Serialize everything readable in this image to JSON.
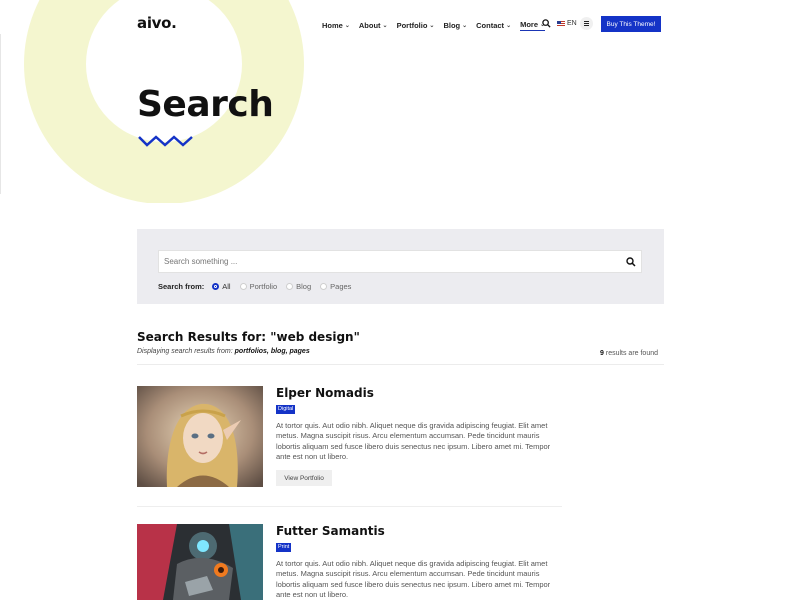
{
  "header": {
    "logo": "aivo.",
    "nav": [
      {
        "label": "Home"
      },
      {
        "label": "About"
      },
      {
        "label": "Portfolio"
      },
      {
        "label": "Blog"
      },
      {
        "label": "Contact"
      },
      {
        "label": "More"
      }
    ],
    "language": "EN",
    "buy_button": "Buy This Theme!"
  },
  "hero": {
    "title": "Search"
  },
  "search": {
    "placeholder": "Search something ...",
    "from_label": "Search from:",
    "options": [
      {
        "label": "All",
        "selected": true
      },
      {
        "label": "Portfolio",
        "selected": false
      },
      {
        "label": "Blog",
        "selected": false
      },
      {
        "label": "Pages",
        "selected": false
      }
    ]
  },
  "results": {
    "heading": "Search Results for: \"web design\"",
    "displaying_prefix": "Displaying search results from:",
    "displaying_sources": "portfolios, blog, pages",
    "count": "9",
    "count_suffix": "results are found",
    "items": [
      {
        "title": "Elper Nomadis",
        "tag": "Digital",
        "description": "At tortor quis. Aut odio nibh. Aliquet neque dis gravida adipiscing feugiat. Elit amet metus. Magna suscipit risus. Arcu elementum accumsan. Pede tincidunt mauris lobortis aliquam sed fusce libero duis senectus nec ipsum. Libero amet mi. Tempor ante est non ut libero.",
        "button": "View Portfolio"
      },
      {
        "title": "Futter Samantis",
        "tag": "Print",
        "description": "At tortor quis. Aut odio nibh. Aliquet neque dis gravida adipiscing feugiat. Elit amet metus. Magna suscipit risus. Arcu elementum accumsan. Pede tincidunt mauris lobortis aliquam sed fusce libero duis senectus nec ipsum. Libero amet mi. Tempor ante est non ut libero."
      }
    ]
  },
  "colors": {
    "accent": "#1433c7",
    "ring": "#f4f6cf",
    "panel": "#ececf0"
  }
}
